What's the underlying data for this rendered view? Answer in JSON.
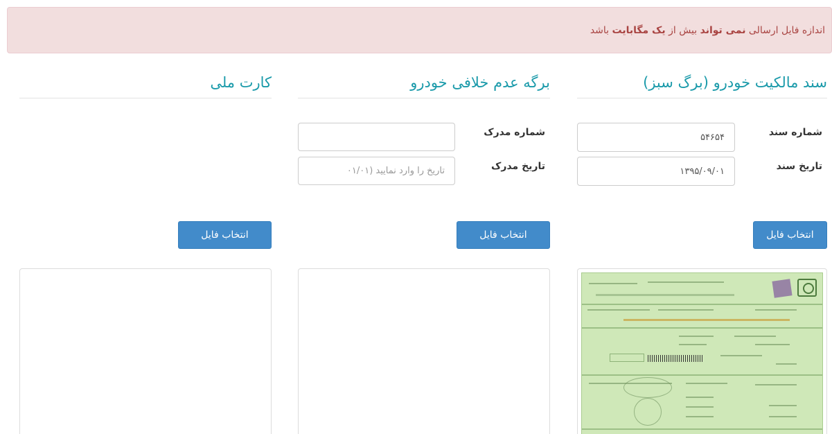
{
  "alert": {
    "pre": "اندازه فایل ارسالی ",
    "strong1": "نمی تواند",
    "mid": " بیش از ",
    "strong2": "یک مگابایت",
    "post": " باشد"
  },
  "sections": [
    {
      "title": "سند مالکیت خودرو (برگ سبز)",
      "field1_label": "شماره سند",
      "field1_value": "۵۴۶۵۴",
      "field2_label": "تاریخ سند",
      "field2_value": "۱۳۹۵/۰۹/۰۱",
      "button_label": "انتخاب فایل"
    },
    {
      "title": "برگه عدم خلافی خودرو",
      "field1_label": "شماره مدرک",
      "field1_value": "",
      "field2_label": "تاریخ مدرک",
      "field2_placeholder": "تاریخ را وارد نمایید (۰۱/۰۱",
      "button_label": "انتخاب فایل"
    },
    {
      "title": "کارت ملی",
      "button_label": "انتخاب فایل"
    }
  ]
}
